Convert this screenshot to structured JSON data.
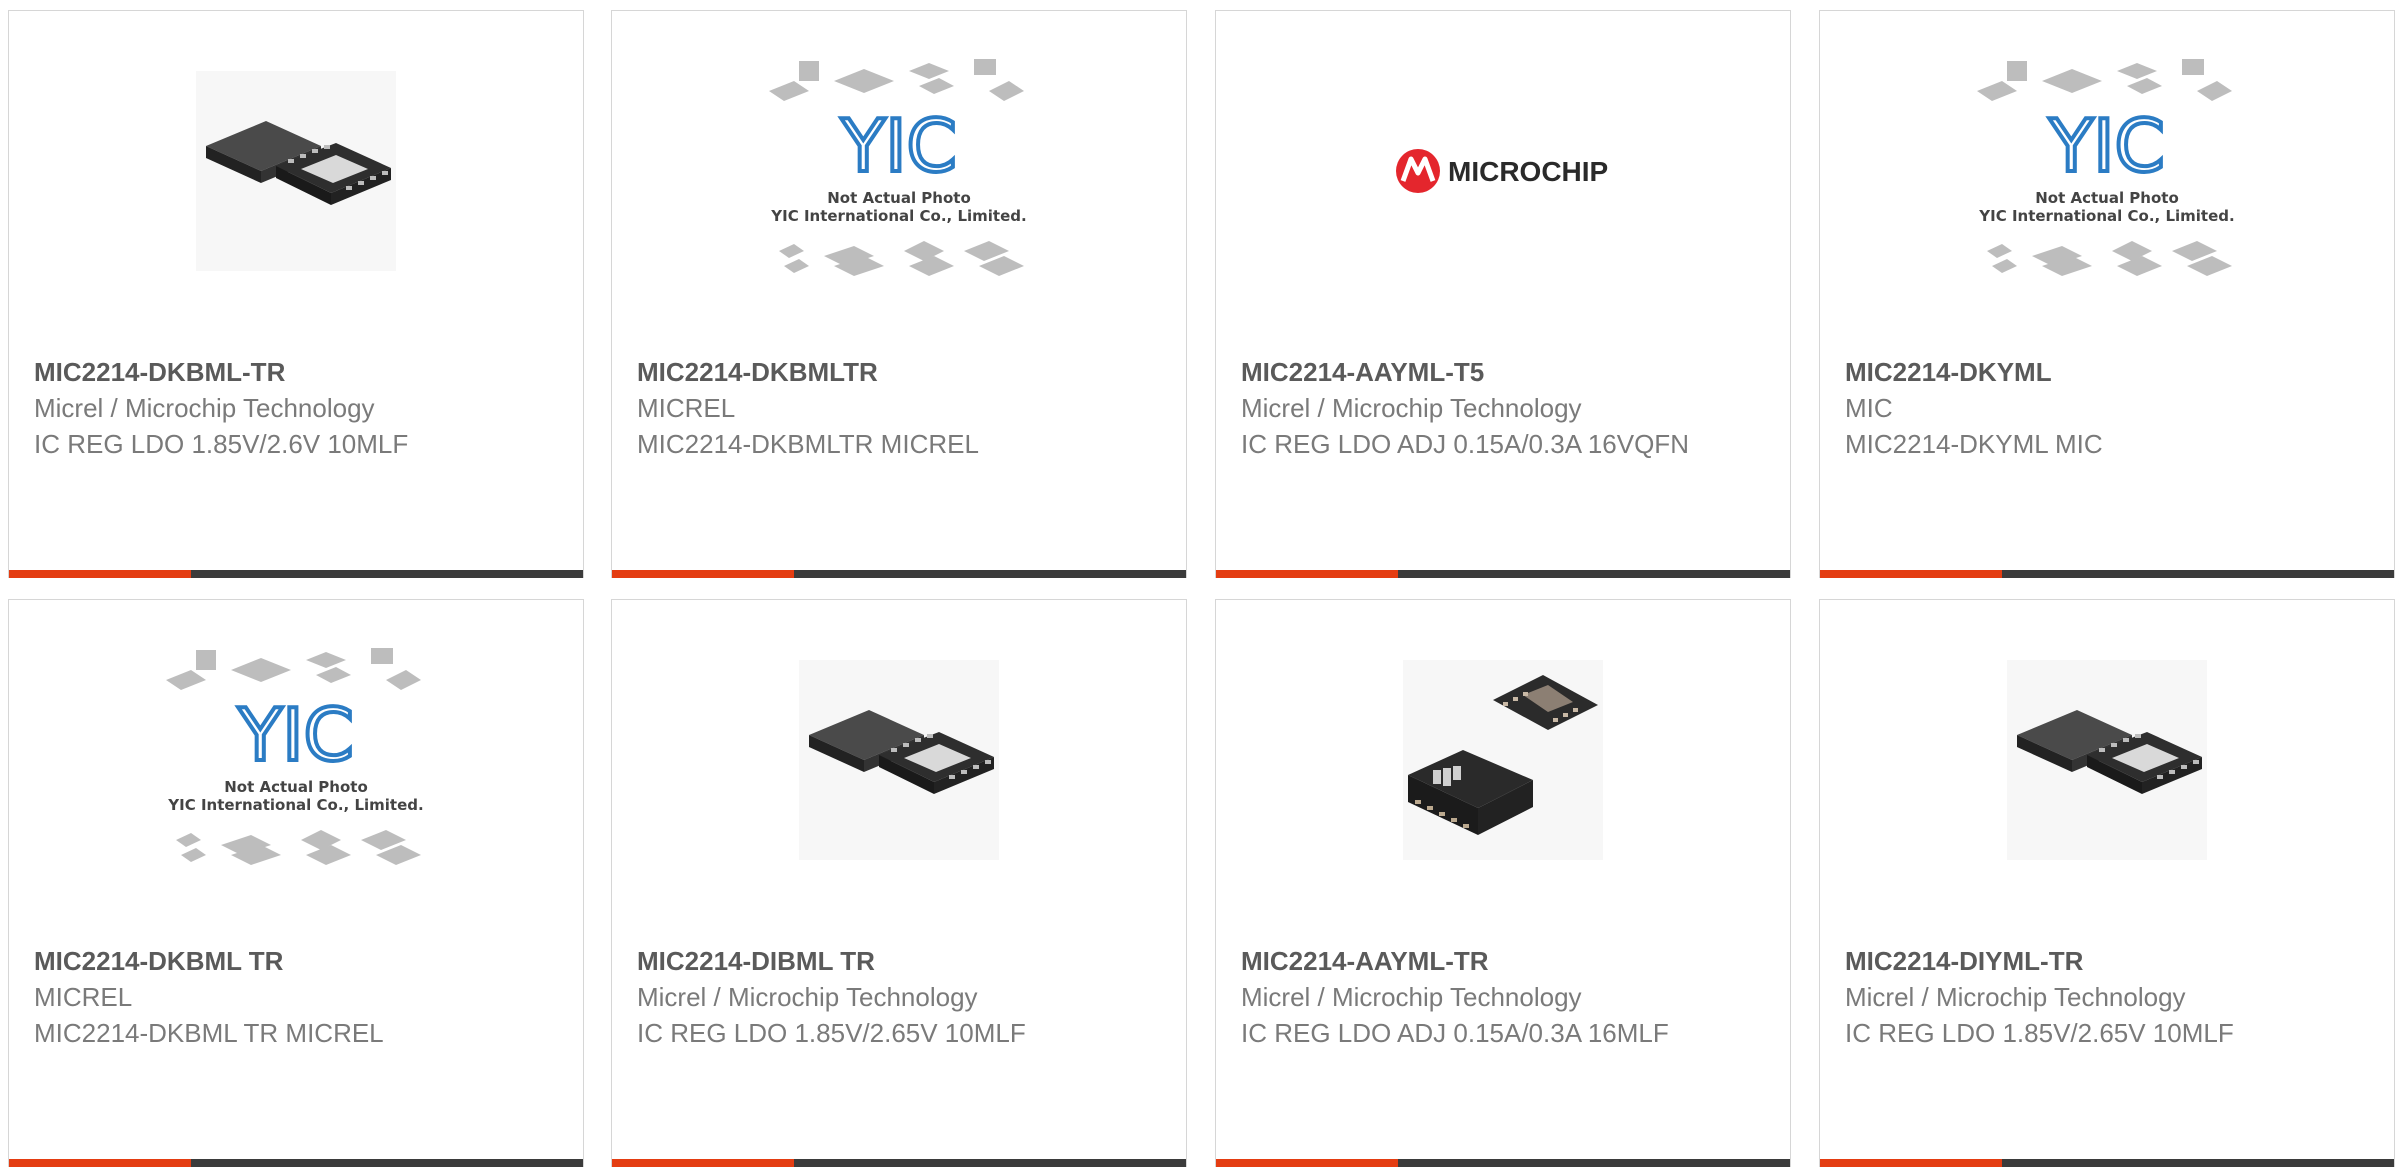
{
  "products": [
    {
      "part": "MIC2214-DKBML-TR",
      "manufacturer": "Micrel / Microchip Technology",
      "description": "IC REG LDO 1.85V/2.6V 10MLF",
      "image": "ic-package-photo-icon"
    },
    {
      "part": "MIC2214-DKBMLTR",
      "manufacturer": "MICREL",
      "description": "MIC2214-DKBMLTR MICREL",
      "image": "yic-placeholder-icon"
    },
    {
      "part": "MIC2214-AAYML-T5",
      "manufacturer": "Micrel / Microchip Technology",
      "description": "IC REG LDO ADJ 0.15A/0.3A 16VQFN",
      "image": "microchip-logo-icon"
    },
    {
      "part": "MIC2214-DKYML",
      "manufacturer": "MIC",
      "description": "MIC2214-DKYML MIC",
      "image": "yic-placeholder-icon"
    },
    {
      "part": "MIC2214-DKBML TR",
      "manufacturer": "MICREL",
      "description": "MIC2214-DKBML TR MICREL",
      "image": "yic-placeholder-icon"
    },
    {
      "part": "MIC2214-DIBML TR",
      "manufacturer": "Micrel / Microchip Technology",
      "description": "IC REG LDO 1.85V/2.65V 10MLF",
      "image": "ic-package-photo-icon"
    },
    {
      "part": "MIC2214-AAYML-TR",
      "manufacturer": "Micrel / Microchip Technology",
      "description": "IC REG LDO ADJ 0.15A/0.3A 16MLF",
      "image": "qfn-package-photo-icon"
    },
    {
      "part": "MIC2214-DIYML-TR",
      "manufacturer": "Micrel / Microchip Technology",
      "description": "IC REG LDO 1.85V/2.65V 10MLF",
      "image": "ic-package-photo-icon"
    }
  ],
  "placeholder": {
    "line1": "Not Actual Photo",
    "line2": "YIC International Co., Limited.",
    "logo_text": "YIC"
  },
  "brand": {
    "microchip_text": "MICROCHIP"
  },
  "colors": {
    "accent": "#e43d12",
    "bar": "#3b3b3b",
    "border": "#d6d6d6",
    "part_text": "#5a5a5a",
    "body_text": "#7a7a7a"
  }
}
